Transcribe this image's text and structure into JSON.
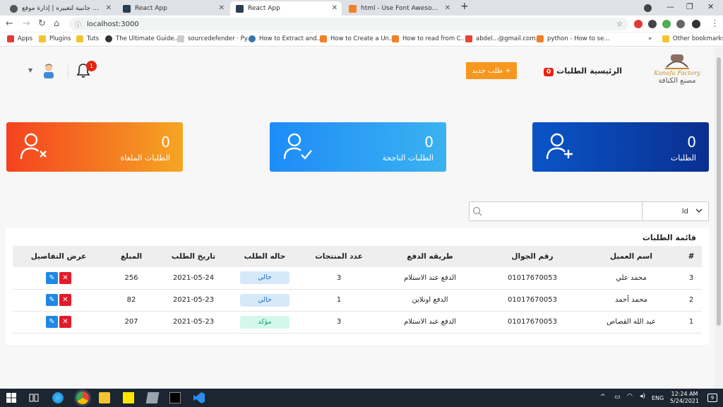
{
  "browser": {
    "tabs": [
      {
        "title": "اختر إضافة جانبية لتغييره | إدارة موقع",
        "active": false
      },
      {
        "title": "React App",
        "active": false
      },
      {
        "title": "React App",
        "active": true
      },
      {
        "title": "html - Use Font Awesome Icon in",
        "active": false
      }
    ],
    "url": "localhost:3000",
    "bookmarks": [
      "Apps",
      "Plugins",
      "Tuts",
      "The Ultimate Guide...",
      "sourcedefender · Py...",
      "How to Extract and...",
      "How to Create a Un...",
      "How to read from C...",
      "abdel...@gmail.com...",
      "python - How to se..."
    ],
    "other_bookmarks": "Other bookmarks",
    "more": "»"
  },
  "navbar": {
    "logo_brand": "Kunafa Factory",
    "logo_arabic": "مصنع الكنافة",
    "home": "الرئيسية",
    "orders": "الطلبات",
    "orders_count": "0",
    "new_order": "طلب جديد +",
    "notifications_count": "1"
  },
  "cards": [
    {
      "value": "0",
      "label": "الطلبات",
      "icon": "user-plus-icon"
    },
    {
      "value": "0",
      "label": "الطلبات الناجحة",
      "icon": "user-check-icon"
    },
    {
      "value": "0",
      "label": "الطلبات الملغاة",
      "icon": "user-x-icon"
    }
  ],
  "search": {
    "placeholder": "",
    "field": "Id"
  },
  "table": {
    "title": "قائمة الطلبات",
    "headers": [
      "#",
      "اسم العميل",
      "رقم الجوال",
      "طريقه الدفع",
      "عدد المنتجات",
      "حاله الطلب",
      "تاريخ الطلب",
      "المبلغ",
      "عرض التفاصيل"
    ],
    "rows": [
      {
        "id": "3",
        "customer": "محمد علي",
        "phone": "01017670053",
        "payment": "الدفع عند الاستلام",
        "products": "3",
        "status": "حالي",
        "date": "2021-05-24",
        "amount": "256"
      },
      {
        "id": "2",
        "customer": "محمد أحمد",
        "phone": "01017670053",
        "payment": "الدفع اونلاين",
        "products": "1",
        "status": "حالي",
        "date": "2021-05-23",
        "amount": "82"
      },
      {
        "id": "1",
        "customer": "عبد الله القصاص",
        "phone": "01017670053",
        "payment": "الدفع عند الاستلام",
        "products": "3",
        "status": "مؤكد",
        "date": "2021-05-23",
        "amount": "207"
      }
    ]
  },
  "colors": {
    "accent_orange": "#f7971e",
    "badge_red": "#e8230f",
    "status_current_bg": "#d6e9fb",
    "status_current_fg": "#1e6fc2",
    "status_confirmed_bg": "#d4f7ec",
    "status_confirmed_fg": "#17a37a"
  },
  "taskbar": {
    "time": "12:24 AM",
    "date": "5/24/2021",
    "lang": "ENG",
    "notifications": "9"
  }
}
